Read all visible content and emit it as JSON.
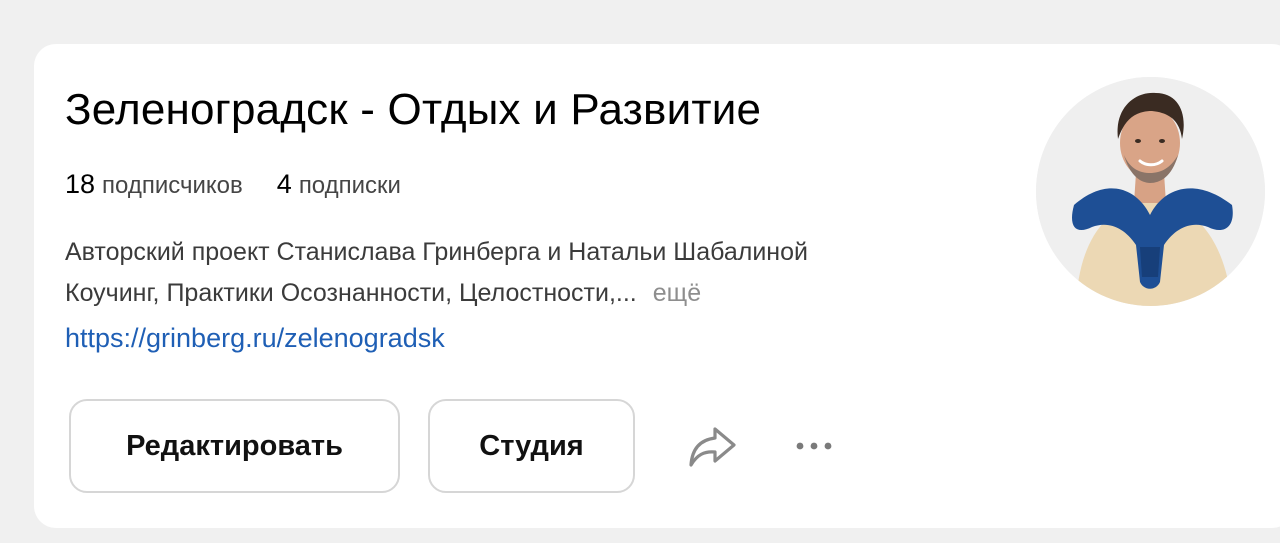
{
  "channel": {
    "title": "Зеленоградск - Отдых и Развитие",
    "stats": [
      {
        "value": "18",
        "label": "подписчиков"
      },
      {
        "value": "4",
        "label": "подписки"
      }
    ],
    "description": {
      "line1": "Авторский проект Станислава Гринберга и Натальи Шабалиной",
      "line2": "Коучинг, Практики Осознанности, Целостности,...",
      "more_label": "ещё"
    },
    "link": "https://grinberg.ru/zelenogradsk"
  },
  "actions": {
    "edit_label": "Редактировать",
    "studio_label": "Студия",
    "share_icon": "share-icon",
    "more_icon": "more-horizontal-icon"
  },
  "colors": {
    "page_background": "#f0f0f0",
    "card_background": "#ffffff",
    "link": "#1f5fb5",
    "muted_text": "#8e8e8e",
    "button_border": "#d6d6d6"
  }
}
